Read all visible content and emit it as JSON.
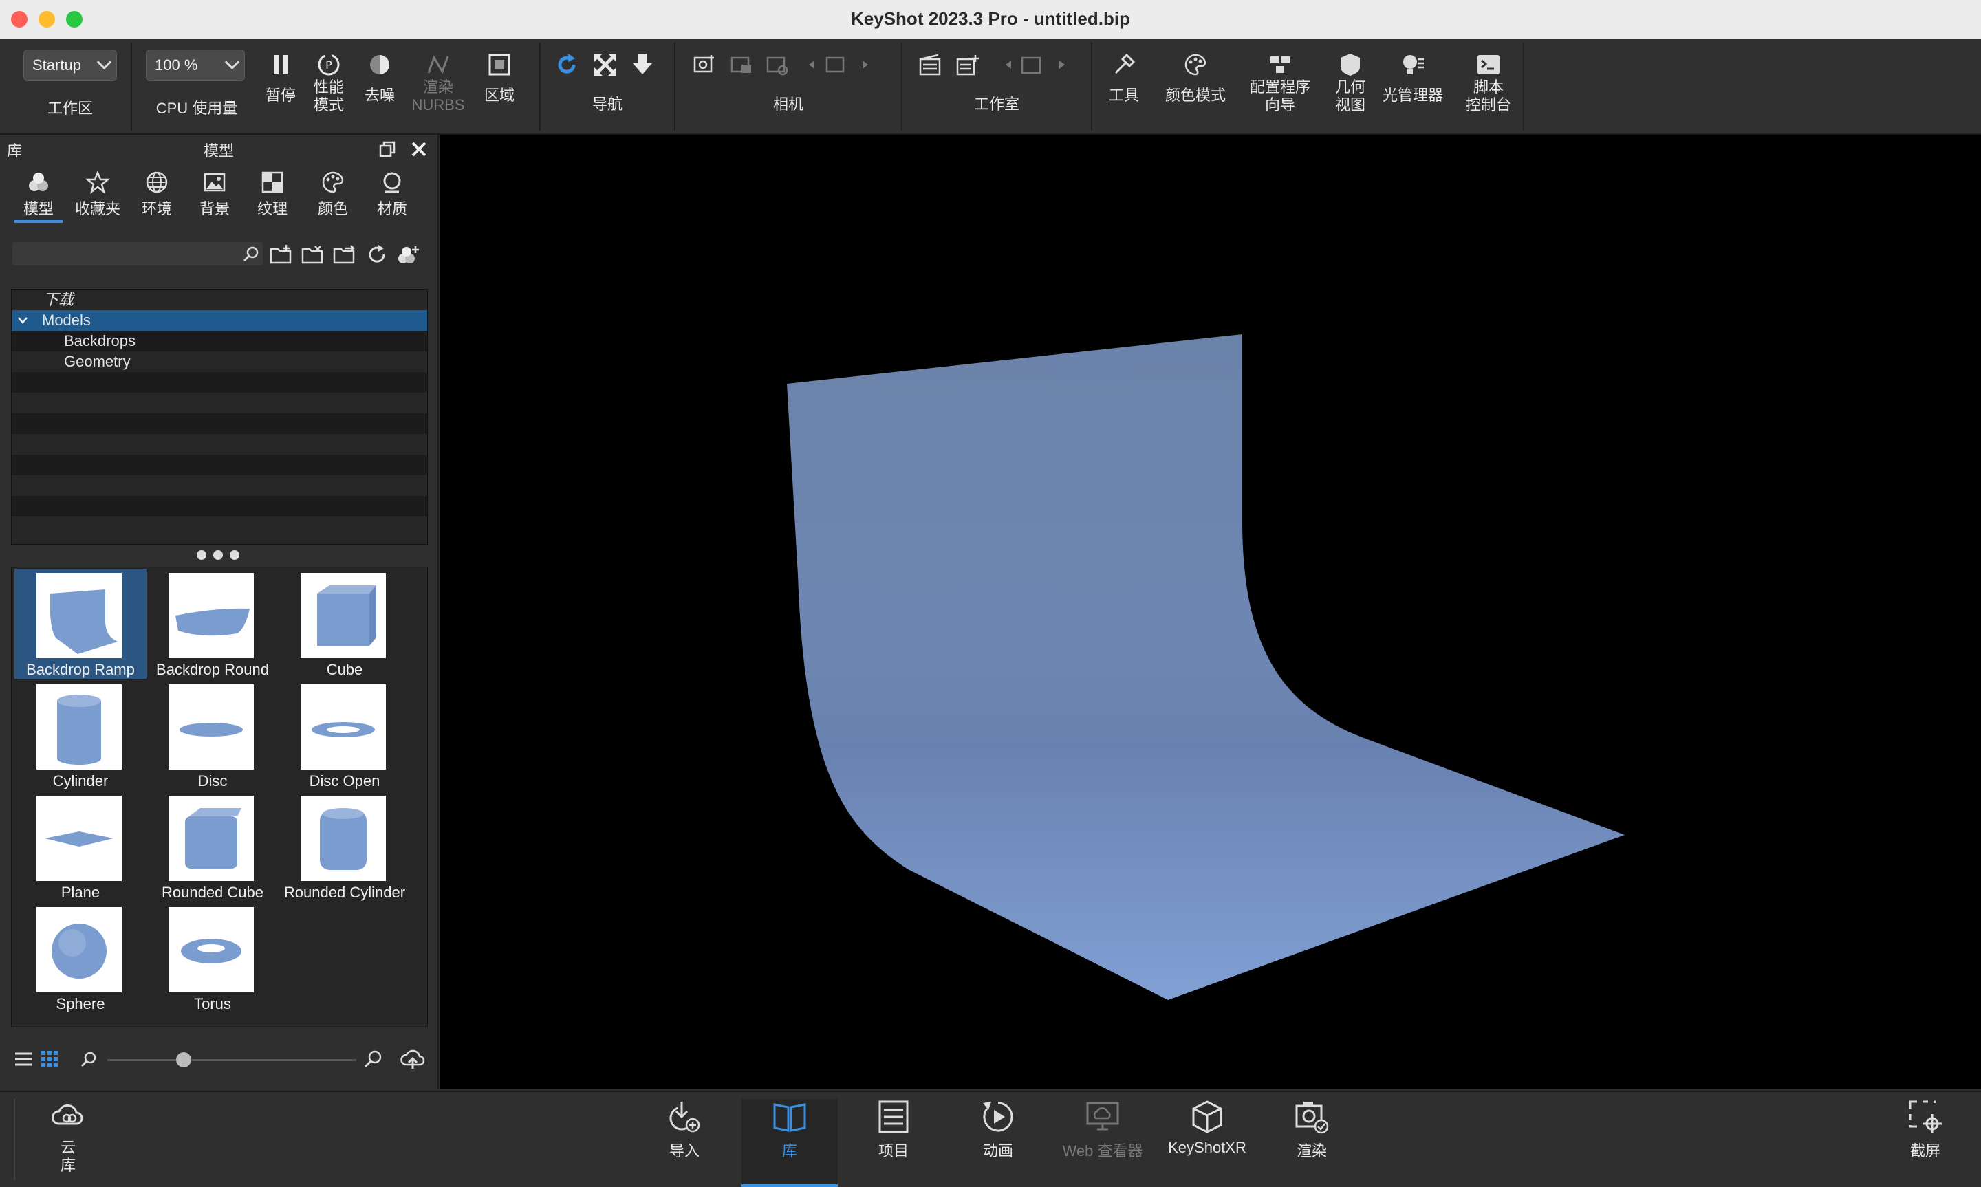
{
  "window": {
    "title": "KeyShot 2023.3 Pro  - untitled.bip"
  },
  "toolbar": {
    "workspace": {
      "value": "Startup",
      "label": "工作区"
    },
    "cpu": {
      "value": "100 %",
      "label": "CPU 使用量"
    },
    "pause": "暂停",
    "performance_mode": "性能\n模式",
    "denoise": "去噪",
    "render_nurbs": "渲染\nNURBS",
    "region": "区域",
    "navigation": "导航",
    "camera": "相机",
    "studio": "工作室",
    "tools": "工具",
    "color_mode": "颜色模式",
    "config_wizard": "配置程序\n向导",
    "geometry_view": "几何\n视图",
    "light_manager": "光管理器",
    "script_console": "脚本\n控制台"
  },
  "library": {
    "panel_label": "库",
    "title": "模型",
    "tabs": [
      "模型",
      "收藏夹",
      "环境",
      "背景",
      "纹理",
      "颜色",
      "材质"
    ],
    "search_placeholder": "",
    "tree": {
      "download": "下载",
      "models": "Models",
      "children": [
        "Backdrops",
        "Geometry"
      ]
    },
    "items": [
      "Backdrop Ramp",
      "Backdrop Round",
      "Cube",
      "Cylinder",
      "Disc",
      "Disc Open",
      "Plane",
      "Rounded Cube",
      "Rounded Cylinder",
      "Sphere",
      "Torus"
    ],
    "selected_item": "Backdrop Ramp"
  },
  "bottom": {
    "cloud_library": "云\n库",
    "import": "导入",
    "library": "库",
    "project": "项目",
    "animation": "动画",
    "web_viewer": "Web 查看器",
    "keyshotxr": "KeyShotXR",
    "render": "渲染",
    "screenshot": "截屏"
  },
  "colors": {
    "accent": "#3b8fe0",
    "selection": "#1f5a8f",
    "backdrop": "#7b9ccf"
  }
}
